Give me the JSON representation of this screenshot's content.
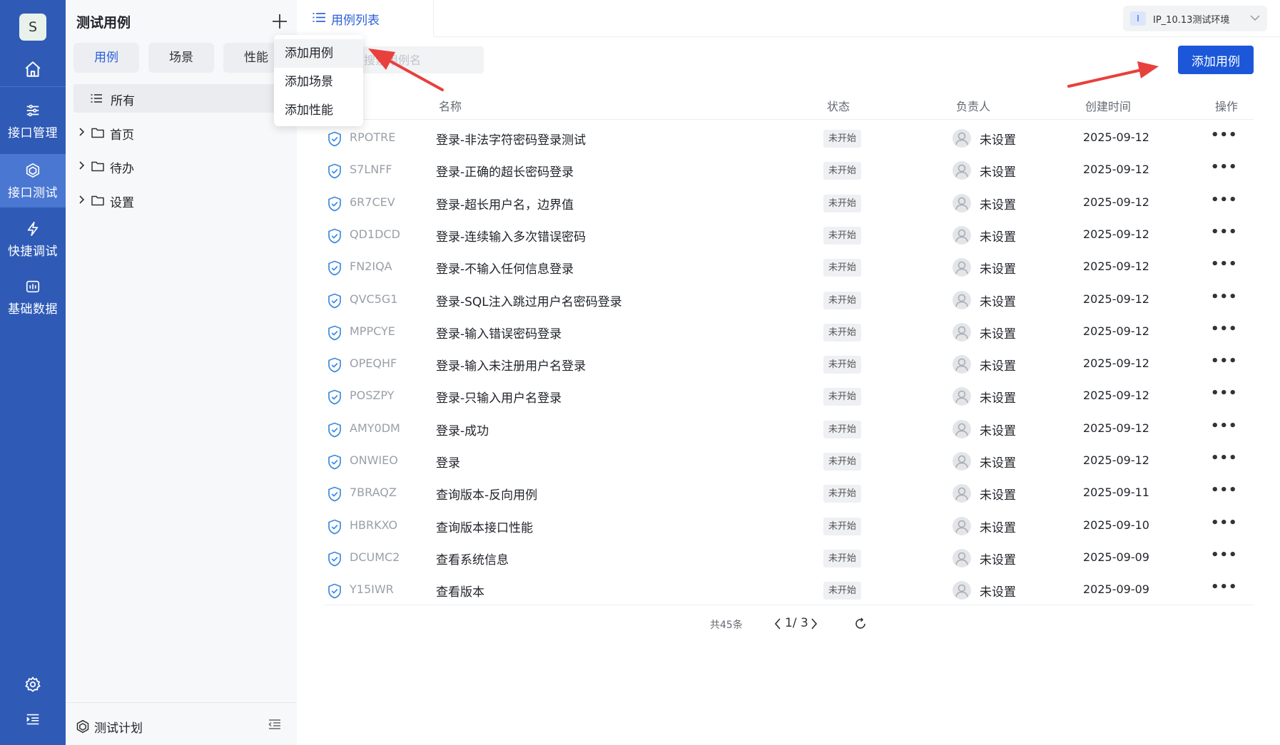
{
  "sidebar": {
    "avatar_letter": "S",
    "items": [
      {
        "label": "接口管理",
        "icon": "sliders-icon"
      },
      {
        "label": "接口测试",
        "icon": "cube-icon",
        "active": true
      },
      {
        "label": "快捷调试",
        "icon": "lightning-icon"
      },
      {
        "label": "基础数据",
        "icon": "data-icon"
      }
    ]
  },
  "panel": {
    "title": "测试用例",
    "segments": [
      {
        "label": "用例",
        "active": true
      },
      {
        "label": "场景"
      },
      {
        "label": "性能"
      }
    ],
    "tree_all": "所有",
    "folders": [
      "首页",
      "待办",
      "设置"
    ],
    "footer_label": "测试计划"
  },
  "dropdown": {
    "items": [
      "添加用例",
      "添加场景",
      "添加性能"
    ]
  },
  "tabs": [
    {
      "label": "用例列表",
      "active": true
    }
  ],
  "env": {
    "badge": "I",
    "label": "IP_10.13测试环境"
  },
  "search": {
    "placeholder": "搜索用例名"
  },
  "add_button": "添加用例",
  "table": {
    "columns": [
      "名称",
      "状态",
      "负责人",
      "创建时间",
      "操作"
    ],
    "rows": [
      {
        "id": "RPOTRE",
        "name": "登录-非法字符密码登录测试",
        "status": "未开始",
        "owner": "未设置",
        "date": "2025-09-12"
      },
      {
        "id": "S7LNFF",
        "name": "登录-正确的超长密码登录",
        "status": "未开始",
        "owner": "未设置",
        "date": "2025-09-12"
      },
      {
        "id": "6R7CEV",
        "name": "登录-超长用户名，边界值",
        "status": "未开始",
        "owner": "未设置",
        "date": "2025-09-12"
      },
      {
        "id": "QD1DCD",
        "name": "登录-连续输入多次错误密码",
        "status": "未开始",
        "owner": "未设置",
        "date": "2025-09-12"
      },
      {
        "id": "FN2IQA",
        "name": "登录-不输入任何信息登录",
        "status": "未开始",
        "owner": "未设置",
        "date": "2025-09-12"
      },
      {
        "id": "QVC5G1",
        "name": "登录-SQL注入跳过用户名密码登录",
        "status": "未开始",
        "owner": "未设置",
        "date": "2025-09-12"
      },
      {
        "id": "MPPCYE",
        "name": "登录-输入错误密码登录",
        "status": "未开始",
        "owner": "未设置",
        "date": "2025-09-12"
      },
      {
        "id": "OPEQHF",
        "name": "登录-输入未注册用户名登录",
        "status": "未开始",
        "owner": "未设置",
        "date": "2025-09-12"
      },
      {
        "id": "POSZPY",
        "name": "登录-只输入用户名登录",
        "status": "未开始",
        "owner": "未设置",
        "date": "2025-09-12"
      },
      {
        "id": "AMY0DM",
        "name": "登录-成功",
        "status": "未开始",
        "owner": "未设置",
        "date": "2025-09-12"
      },
      {
        "id": "ONWIEO",
        "name": "登录",
        "status": "未开始",
        "owner": "未设置",
        "date": "2025-09-12"
      },
      {
        "id": "7BRAQZ",
        "name": "查询版本-反向用例",
        "status": "未开始",
        "owner": "未设置",
        "date": "2025-09-11"
      },
      {
        "id": "HBRKXO",
        "name": "查询版本接口性能",
        "status": "未开始",
        "owner": "未设置",
        "date": "2025-09-10"
      },
      {
        "id": "DCUMC2",
        "name": "查看系统信息",
        "status": "未开始",
        "owner": "未设置",
        "date": "2025-09-09"
      },
      {
        "id": "Y15IWR",
        "name": "查看版本",
        "status": "未开始",
        "owner": "未设置",
        "date": "2025-09-09"
      }
    ],
    "more_glyph": "•••"
  },
  "pagination": {
    "total": "共45条",
    "page_text": "1/ 3"
  },
  "colors": {
    "rail": "#2f5bb7",
    "accent": "#1b57d8",
    "annotation": "#e8403c"
  }
}
